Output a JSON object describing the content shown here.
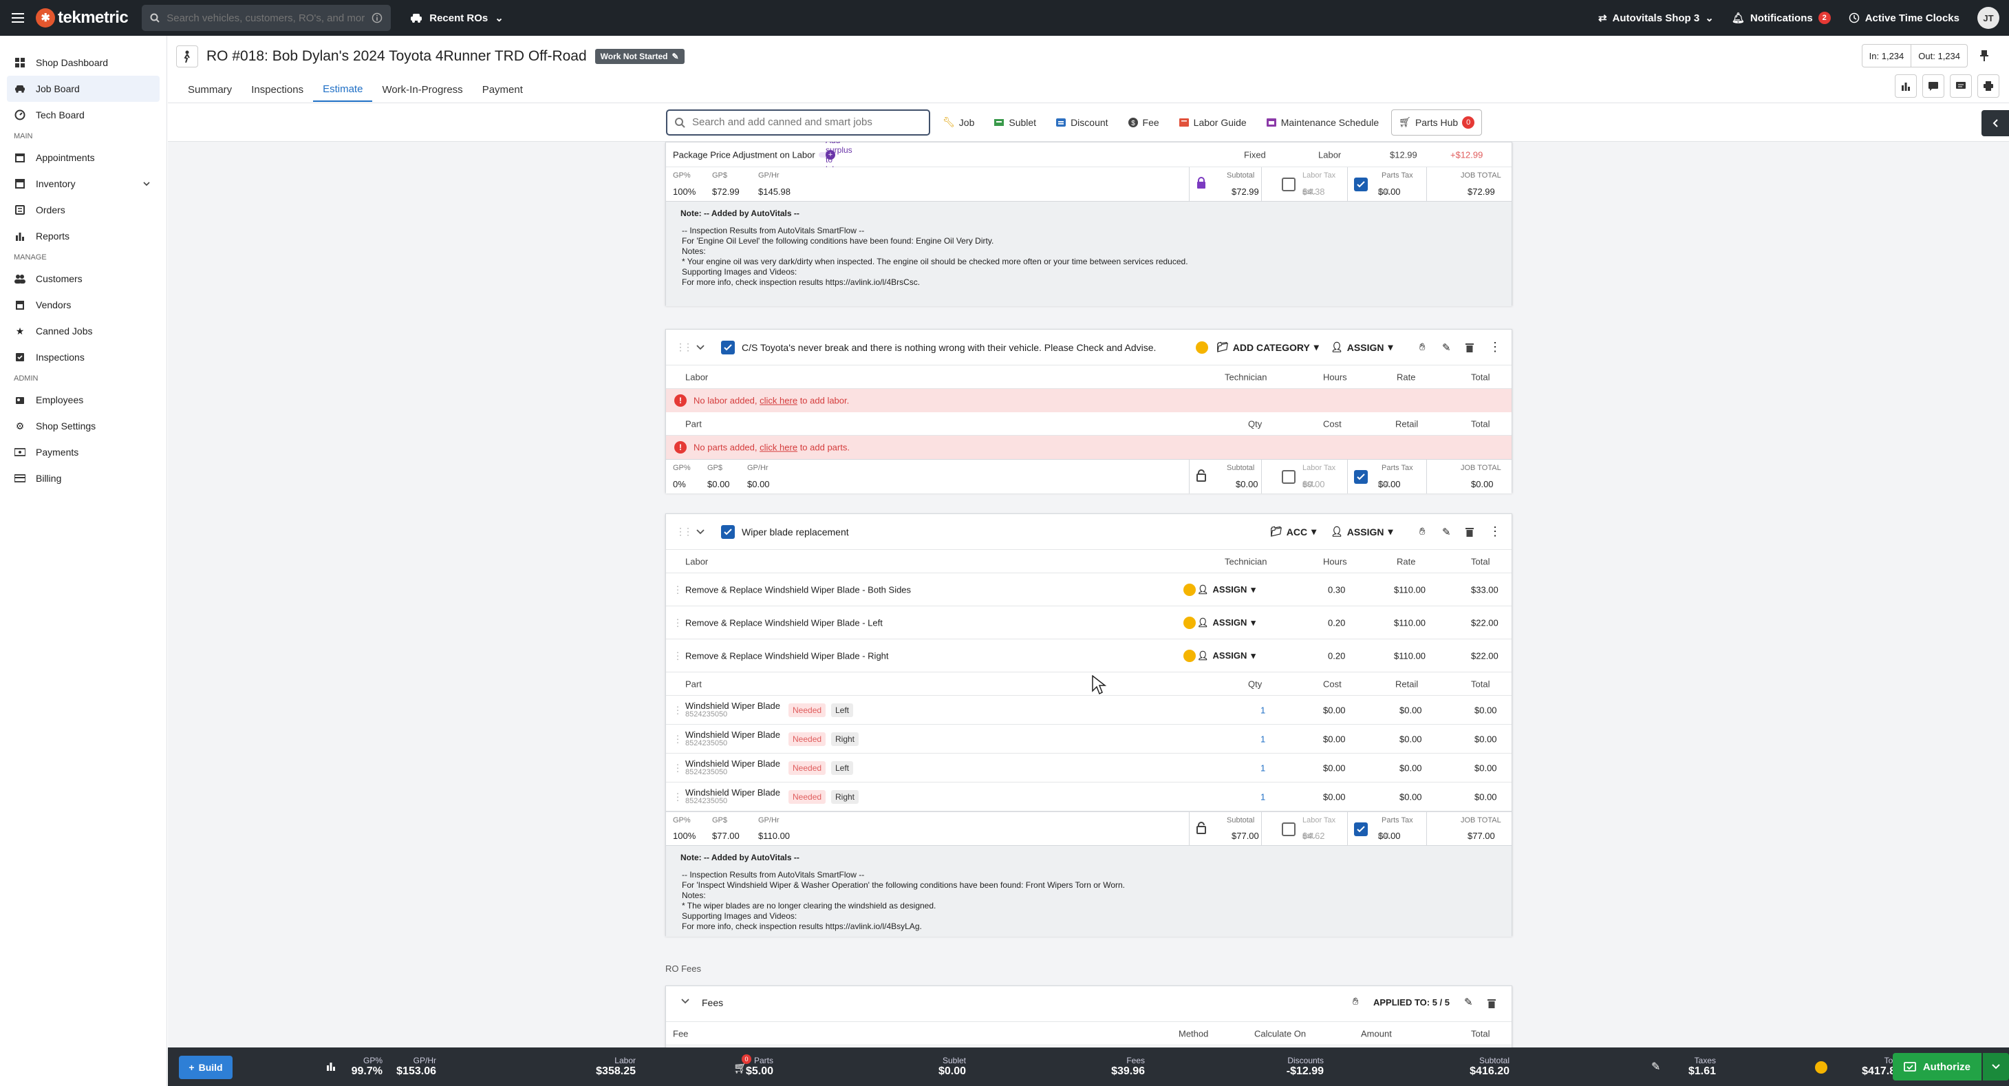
{
  "topbar": {
    "logo": "tekmetric",
    "search_placeholder": "Search vehicles, customers, RO's, and mor...",
    "recent_ros": "Recent ROs",
    "shop": "Autovitals Shop 3",
    "notifications": "Notifications",
    "notifications_count": "2",
    "time_clocks": "Active Time Clocks",
    "avatar": "JT"
  },
  "sidebar": {
    "top_items": [
      {
        "label": "Shop Dashboard"
      },
      {
        "label": "Job Board"
      },
      {
        "label": "Tech Board"
      }
    ],
    "caption_main": "MAIN",
    "main_items": [
      {
        "label": "Appointments"
      },
      {
        "label": "Inventory"
      },
      {
        "label": "Orders"
      },
      {
        "label": "Reports"
      }
    ],
    "caption_manage": "MANAGE",
    "manage_items": [
      {
        "label": "Customers"
      },
      {
        "label": "Vendors"
      },
      {
        "label": "Canned Jobs"
      },
      {
        "label": "Inspections"
      }
    ],
    "caption_admin": "ADMIN",
    "admin_items": [
      {
        "label": "Employees"
      },
      {
        "label": "Shop Settings"
      },
      {
        "label": "Payments"
      },
      {
        "label": "Billing"
      }
    ]
  },
  "header": {
    "title": "RO #018: Bob Dylan's 2024 Toyota 4Runner TRD Off-Road",
    "status": "Work Not Started",
    "in": "In: 1,234",
    "out": "Out: 1,234",
    "tabs": [
      "Summary",
      "Inspections",
      "Estimate",
      "Work-In-Progress",
      "Payment"
    ],
    "active_tab": "Estimate"
  },
  "toolbar": {
    "search_placeholder": "Search and add canned and smart jobs",
    "job": "Job",
    "sublet": "Sublet",
    "discount": "Discount",
    "fee": "Fee",
    "labor_guide": "Labor Guide",
    "maintenance": "Maintenance Schedule",
    "parts_hub": "Parts Hub",
    "parts_hub_count": "0"
  },
  "job1": {
    "adjust_label": "Package Price Adjustment on Labor",
    "add_surplus": "Add surplus to labor",
    "fixed": "Fixed",
    "labor": "Labor",
    "amount": "$12.99",
    "surplus": "+$12.99",
    "gp_pct_label": "GP%",
    "gp_pct": "100%",
    "gp_label": "GP$",
    "gp": "$72.99",
    "gphr_label": "GP/Hr",
    "gphr": "$145.98",
    "subtotal_label": "Subtotal",
    "subtotal": "$72.99",
    "labor_tax_label": "Labor Tax",
    "labor_tax": "$4.38",
    "parts_tax_label": "Parts Tax",
    "parts_tax": "$0.00",
    "est": "est.",
    "total_label": "JOB TOTAL",
    "total": "$72.99",
    "note_title": "Note: -- Added by AutoVitals --",
    "note_lines": [
      "-- Inspection Results from AutoVitals SmartFlow --",
      "For 'Engine Oil Level' the following conditions have been found: Engine Oil Very Dirty.",
      "Notes:",
      "* Your engine oil was very dark/dirty when inspected. The engine oil should be checked more often or your time between services reduced.",
      "Supporting Images and Videos:",
      "For more info, check inspection results https://avlink.io/l/4BrsCsc."
    ]
  },
  "job2": {
    "title": "C/S Toyota's never break and there is nothing wrong with their vehicle. Please Check and Advise.",
    "add_category": "ADD CATEGORY",
    "assign": "ASSIGN",
    "labor_cols": [
      "Labor",
      "Technician",
      "Hours",
      "Rate",
      "Total"
    ],
    "no_labor_pre": "No labor added,",
    "click_here": "click here",
    "no_labor_post": "to add labor.",
    "part_cols": [
      "Part",
      "Qty",
      "Cost",
      "Retail",
      "Total"
    ],
    "no_parts_pre": "No parts added,",
    "no_parts_post": "to add parts.",
    "gp_pct": "0%",
    "gp": "$0.00",
    "gphr": "$0.00",
    "subtotal": "$0.00",
    "labor_tax": "$0.00",
    "parts_tax": "$0.00",
    "total": "$0.00"
  },
  "job3": {
    "title": "Wiper blade replacement",
    "category": "ACC",
    "assign": "ASSIGN",
    "labor_rows": [
      {
        "name": "Remove & Replace Windshield Wiper Blade - Both Sides",
        "tech": "ASSIGN",
        "hours": "0.30",
        "rate": "$110.00",
        "total": "$33.00"
      },
      {
        "name": "Remove & Replace Windshield Wiper Blade - Left",
        "tech": "ASSIGN",
        "hours": "0.20",
        "rate": "$110.00",
        "total": "$22.00"
      },
      {
        "name": "Remove & Replace Windshield Wiper Blade - Right",
        "tech": "ASSIGN",
        "hours": "0.20",
        "rate": "$110.00",
        "total": "$22.00"
      }
    ],
    "parts": [
      {
        "name": "Windshield Wiper Blade",
        "pn": "8524235050",
        "status": "Needed",
        "side": "Left",
        "qty": "1",
        "cost": "$0.00",
        "retail": "$0.00",
        "total": "$0.00"
      },
      {
        "name": "Windshield Wiper Blade",
        "pn": "8524235050",
        "status": "Needed",
        "side": "Right",
        "qty": "1",
        "cost": "$0.00",
        "retail": "$0.00",
        "total": "$0.00"
      },
      {
        "name": "Windshield Wiper Blade",
        "pn": "8524235050",
        "status": "Needed",
        "side": "Left",
        "qty": "1",
        "cost": "$0.00",
        "retail": "$0.00",
        "total": "$0.00"
      },
      {
        "name": "Windshield Wiper Blade",
        "pn": "8524235050",
        "status": "Needed",
        "side": "Right",
        "qty": "1",
        "cost": "$0.00",
        "retail": "$0.00",
        "total": "$0.00"
      }
    ],
    "gp_pct": "100%",
    "gp": "$77.00",
    "gphr": "$110.00",
    "subtotal": "$77.00",
    "labor_tax": "$4.62",
    "parts_tax": "$0.00",
    "total": "$77.00",
    "note_title": "Note: -- Added by AutoVitals --",
    "note_lines": [
      "-- Inspection Results from AutoVitals SmartFlow --",
      "For 'Inspect Windshield Wiper & Washer Operation' the following conditions have been found: Front Wipers Torn or Worn.",
      "Notes:",
      "* The wiper blades are no longer clearing the windshield as designed.",
      "Supporting Images and Videos:",
      "For more info, check inspection results https://avlink.io/l/4BsyLAg."
    ]
  },
  "fees": {
    "section_label": "RO Fees",
    "title": "Fees",
    "applied": "APPLIED TO: 5 / 5",
    "cols": [
      "Fee",
      "Method",
      "Calculate On",
      "Amount",
      "Total"
    ]
  },
  "footer": {
    "build": "Build",
    "gp_label": "GP%",
    "gp": "99.7%",
    "gphr_label": "GP/Hr",
    "gphr": "$153.06",
    "labor_label": "Labor",
    "labor": "$358.25",
    "parts_label": "Parts",
    "parts": "$5.00",
    "parts_badge": "0",
    "sublet_label": "Sublet",
    "sublet": "$0.00",
    "fees_label": "Fees",
    "fees": "$39.96",
    "discounts_label": "Discounts",
    "discounts": "-$12.99",
    "subtotal_label": "Subtotal",
    "subtotal": "$416.20",
    "taxes_label": "Taxes",
    "taxes": "$1.61",
    "total_label": "Total",
    "total": "$417.81",
    "authorize": "Authorize"
  },
  "colors": {
    "accent": "#1f6fc5",
    "topbar": "#1f2429",
    "authorize": "#22a346",
    "error_bg": "#fbe1e1"
  }
}
